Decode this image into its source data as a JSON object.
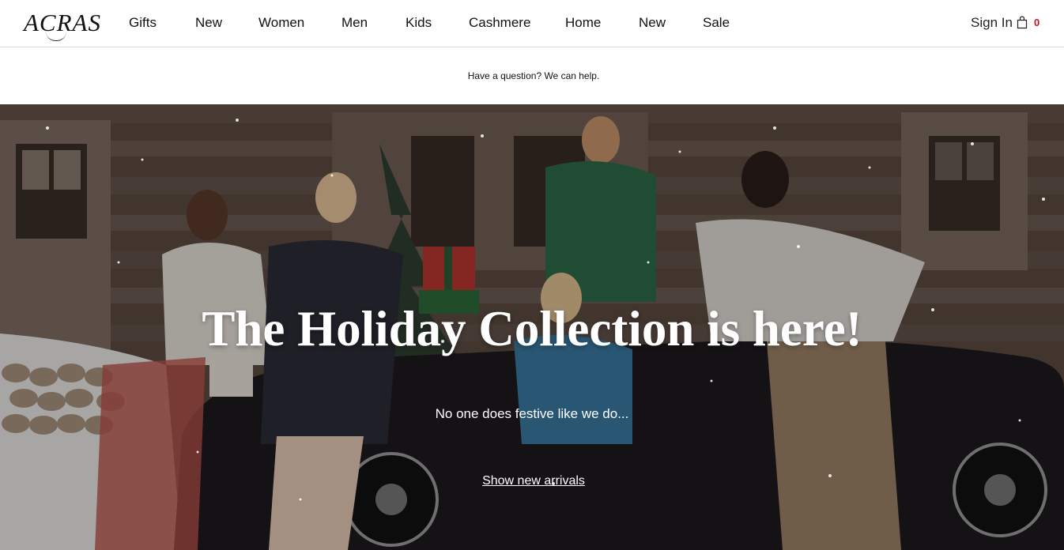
{
  "header": {
    "logo": "ACRAS",
    "nav": [
      "Gifts",
      "New",
      "Women",
      "Men",
      "Kids",
      "Cashmere",
      "Home",
      "New",
      "Sale"
    ],
    "sign_in": "Sign In",
    "bag_count": "0"
  },
  "help_bar": {
    "text": "Have a question? We can help."
  },
  "hero": {
    "title": "The Holiday Collection is here!",
    "subtitle": "No one does festive like we do...",
    "link": "Show new arrivals"
  },
  "colors": {
    "accent": "#c8102e",
    "text": "#111111",
    "divider": "#dcdcdc"
  },
  "icons": [
    "shopping-bag-icon"
  ]
}
